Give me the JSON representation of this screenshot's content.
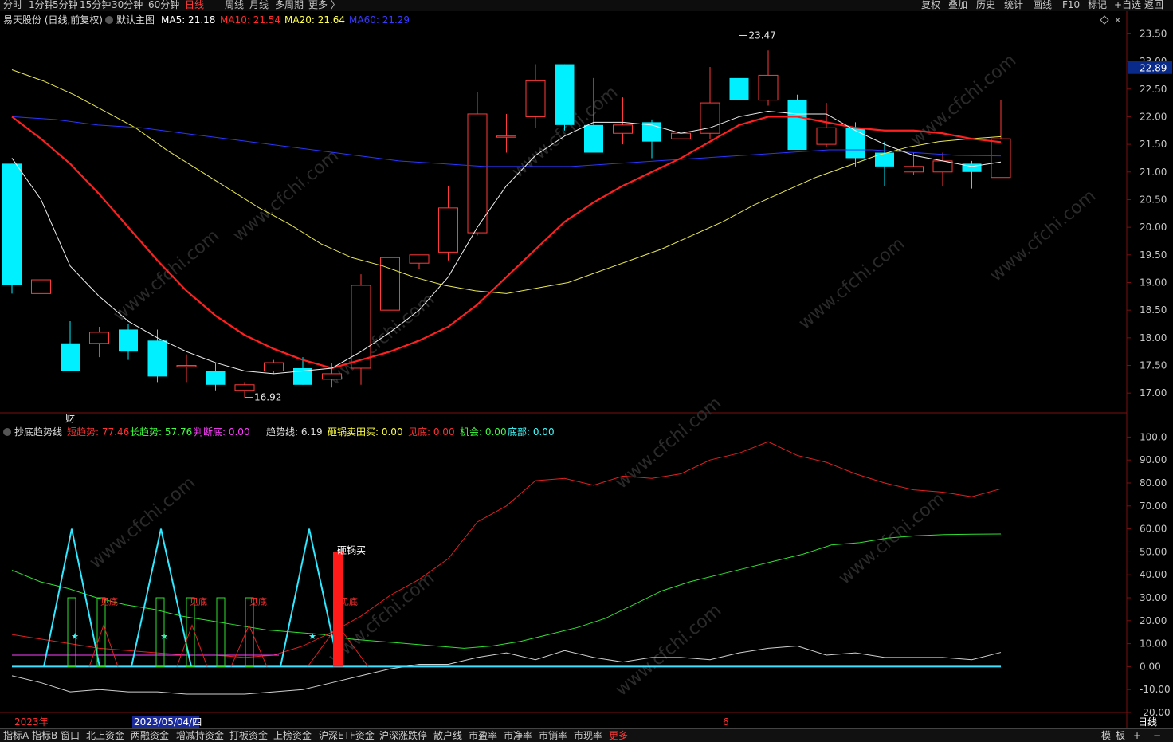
{
  "toolbar": {
    "periods": [
      "分时",
      "1分钟",
      "5分钟",
      "15分钟",
      "30分钟",
      "60分钟",
      "日线",
      "周线",
      "月线",
      "多周期",
      "更多 〉"
    ],
    "active_period": "日线",
    "right_buttons": [
      "复权",
      "叠加",
      "历史",
      "统计",
      "画线",
      "F10",
      "标记",
      "+自选",
      "返回"
    ]
  },
  "main_panel": {
    "stock": "易天股份 (日线,前复权)",
    "indicator": "默认主图",
    "ma": [
      {
        "label": "MA5",
        "value": "21.18",
        "color": "#ffffff"
      },
      {
        "label": "MA10",
        "value": "21.54",
        "color": "#ff2a2a"
      },
      {
        "label": "MA20",
        "value": "21.64",
        "color": "#ffff50"
      },
      {
        "label": "MA60",
        "value": "21.29",
        "color": "#3a3aff"
      }
    ],
    "price_axis": [
      "23.50",
      "23.00",
      "22.50",
      "22.00",
      "21.50",
      "21.00",
      "20.50",
      "20.00",
      "19.50",
      "19.00",
      "18.50",
      "18.00",
      "17.50",
      "17.00"
    ],
    "current_price": "22.89",
    "high_label": "23.47",
    "low_label": "16.92",
    "marker": "财"
  },
  "sub_panel": {
    "name": "抄底趋势线",
    "items": [
      {
        "label": "短趋势",
        "value": "77.46",
        "color": "#ff3030"
      },
      {
        "label": "长趋势",
        "value": "57.76",
        "color": "#40ff40"
      },
      {
        "label": "判断底",
        "value": "0.00",
        "color": "#ff40ff"
      },
      {
        "label": "趋势线",
        "value": "6.19",
        "color": "#dddddd"
      },
      {
        "label": "砸锅卖田买",
        "value": "0.00",
        "color": "#ffff40"
      },
      {
        "label": "见底",
        "value": "0.00",
        "color": "#ff3030"
      },
      {
        "label": "机会",
        "value": "0.00",
        "color": "#40ff40"
      },
      {
        "label": "底部",
        "value": "0.00",
        "color": "#40ffff"
      }
    ],
    "axis": [
      "100.0",
      "90.00",
      "80.00",
      "70.00",
      "60.00",
      "50.00",
      "40.00",
      "30.00",
      "20.00",
      "10.00",
      "0.00",
      "-10.00",
      "-20.00"
    ],
    "annotations": {
      "buy": "砸锅买",
      "bottom": "见底"
    }
  },
  "date_axis": {
    "year": "2023年",
    "cursor_date": "2023/05/04/四",
    "month": "6",
    "period_label": "日线"
  },
  "bottom_tabs": [
    "指标A",
    "指标B",
    "窗口",
    "北上资金",
    "两融资金",
    "增减持资金",
    "打板资金",
    "上榜资金",
    "沪深ETF资金",
    "沪深涨跌停",
    "散户线",
    "市盈率",
    "市净率",
    "市销率",
    "市现率",
    "更多"
  ],
  "bottom_right": [
    "模",
    "板",
    "+",
    "−"
  ],
  "watermark": "www.cfchi.com",
  "chart_data": {
    "type": "candlestick",
    "price_range": [
      16.7,
      23.65
    ],
    "candles": [
      {
        "o": 21.15,
        "h": 21.15,
        "c": 18.95,
        "l": 18.8
      },
      {
        "o": 18.8,
        "h": 19.4,
        "c": 19.05,
        "l": 18.7
      },
      {
        "o": 17.9,
        "h": 18.3,
        "c": 17.4,
        "l": 17.4
      },
      {
        "o": 17.9,
        "h": 18.2,
        "c": 18.1,
        "l": 17.65
      },
      {
        "o": 18.15,
        "h": 18.25,
        "c": 17.75,
        "l": 17.6
      },
      {
        "o": 17.95,
        "h": 18.15,
        "c": 17.3,
        "l": 17.2
      },
      {
        "o": 17.5,
        "h": 17.7,
        "c": 17.5,
        "l": 17.2
      },
      {
        "o": 17.4,
        "h": 17.55,
        "c": 17.15,
        "l": 17.05
      },
      {
        "o": 17.05,
        "h": 17.2,
        "c": 17.15,
        "l": 16.92
      },
      {
        "o": 17.4,
        "h": 17.6,
        "c": 17.55,
        "l": 17.35
      },
      {
        "o": 17.45,
        "h": 17.65,
        "c": 17.15,
        "l": 17.15
      },
      {
        "o": 17.25,
        "h": 17.55,
        "c": 17.35,
        "l": 17.1
      },
      {
        "o": 17.45,
        "h": 19.15,
        "c": 18.95,
        "l": 17.15
      },
      {
        "o": 18.5,
        "h": 19.75,
        "c": 19.45,
        "l": 18.4
      },
      {
        "o": 19.35,
        "h": 19.45,
        "c": 19.5,
        "l": 19.25
      },
      {
        "o": 19.55,
        "h": 20.75,
        "c": 20.35,
        "l": 19.4
      },
      {
        "o": 19.9,
        "h": 22.45,
        "c": 22.05,
        "l": 19.85
      },
      {
        "o": 21.65,
        "h": 22.05,
        "c": 21.65,
        "l": 21.35
      },
      {
        "o": 22.0,
        "h": 22.95,
        "c": 22.65,
        "l": 21.8
      },
      {
        "o": 22.95,
        "h": 22.95,
        "c": 21.85,
        "l": 21.75
      },
      {
        "o": 21.85,
        "h": 22.7,
        "c": 21.35,
        "l": 21.35
      },
      {
        "o": 21.7,
        "h": 22.35,
        "c": 21.85,
        "l": 21.5
      },
      {
        "o": 21.9,
        "h": 21.95,
        "c": 21.55,
        "l": 21.25
      },
      {
        "o": 21.6,
        "h": 21.9,
        "c": 21.7,
        "l": 21.45
      },
      {
        "o": 21.7,
        "h": 22.9,
        "c": 22.25,
        "l": 21.6
      },
      {
        "o": 22.7,
        "h": 23.47,
        "c": 22.3,
        "l": 22.2
      },
      {
        "o": 22.3,
        "h": 23.2,
        "c": 22.75,
        "l": 22.2
      },
      {
        "o": 22.3,
        "h": 22.4,
        "c": 21.4,
        "l": 21.4
      },
      {
        "o": 21.5,
        "h": 22.25,
        "c": 21.8,
        "l": 21.45
      },
      {
        "o": 21.8,
        "h": 21.9,
        "c": 21.25,
        "l": 21.1
      },
      {
        "o": 21.35,
        "h": 21.55,
        "c": 21.1,
        "l": 20.75
      },
      {
        "o": 21.0,
        "h": 21.35,
        "c": 21.1,
        "l": 20.95
      },
      {
        "o": 21.0,
        "h": 21.35,
        "c": 21.2,
        "l": 20.75
      },
      {
        "o": 21.15,
        "h": 21.2,
        "c": 21.0,
        "l": 20.7
      },
      {
        "o": 20.9,
        "h": 22.3,
        "c": 21.6,
        "l": 20.9
      }
    ],
    "ma5": [
      21.25,
      20.5,
      19.3,
      18.75,
      18.3,
      18.0,
      17.75,
      17.55,
      17.4,
      17.35,
      17.4,
      17.45,
      17.75,
      18.1,
      18.5,
      19.1,
      20.0,
      20.75,
      21.3,
      21.65,
      21.9,
      21.9,
      21.85,
      21.7,
      21.8,
      22.0,
      22.1,
      22.05,
      22.05,
      21.75,
      21.5,
      21.3,
      21.2,
      21.1,
      21.18
    ],
    "ma10": [
      22.0,
      21.6,
      21.15,
      20.6,
      20.0,
      19.4,
      18.85,
      18.4,
      18.05,
      17.8,
      17.6,
      17.45,
      17.6,
      17.75,
      17.95,
      18.2,
      18.6,
      19.1,
      19.6,
      20.1,
      20.45,
      20.75,
      21.0,
      21.25,
      21.55,
      21.85,
      22.0,
      22.0,
      21.9,
      21.8,
      21.75,
      21.75,
      21.7,
      21.6,
      21.54
    ],
    "ma20": [
      22.85,
      22.65,
      22.4,
      22.1,
      21.8,
      21.4,
      21.05,
      20.7,
      20.35,
      20.05,
      19.7,
      19.45,
      19.3,
      19.1,
      18.95,
      18.85,
      18.8,
      18.9,
      19.0,
      19.2,
      19.4,
      19.6,
      19.85,
      20.1,
      20.4,
      20.65,
      20.9,
      21.1,
      21.3,
      21.45,
      21.55,
      21.6,
      21.64
    ],
    "ma20_start": 0,
    "ma60": [
      22.0,
      21.95,
      21.85,
      21.8,
      21.7,
      21.6,
      21.5,
      21.4,
      21.3,
      21.2,
      21.15,
      21.1,
      21.1,
      21.1,
      21.15,
      21.2,
      21.25,
      21.3,
      21.35,
      21.4,
      21.4,
      21.35,
      21.3,
      21.29
    ],
    "ma60_step": 1.5,
    "sub_range": [
      -20,
      105
    ],
    "short_trend": [
      14,
      12,
      10,
      8,
      7,
      6,
      5,
      5,
      4,
      5,
      9,
      15,
      22,
      31,
      38,
      47,
      63,
      70,
      81,
      82,
      79,
      83,
      82,
      84,
      90,
      93,
      98,
      92,
      89,
      84,
      80,
      77,
      76,
      74,
      77.46
    ],
    "long_trend": [
      42,
      37,
      34,
      30,
      27,
      25,
      22,
      20,
      18,
      16,
      15,
      14,
      12,
      11,
      10,
      9,
      8,
      9,
      11,
      14,
      17,
      21,
      27,
      33,
      37,
      40,
      43,
      46,
      49,
      53,
      54,
      56,
      57,
      57.5,
      57.7,
      57.76
    ],
    "trend_line": [
      -4,
      -7,
      -11,
      -10,
      -11,
      -11,
      -12,
      -12,
      -12,
      -11,
      -10,
      -7,
      -4,
      -1,
      1,
      1,
      4,
      6,
      3,
      7,
      4,
      2,
      4,
      4,
      3,
      6,
      8,
      9,
      5,
      6,
      4,
      4,
      4,
      3,
      6.19
    ],
    "spike_tops": [
      60,
      60,
      60
    ],
    "buy_bar": 50
  }
}
